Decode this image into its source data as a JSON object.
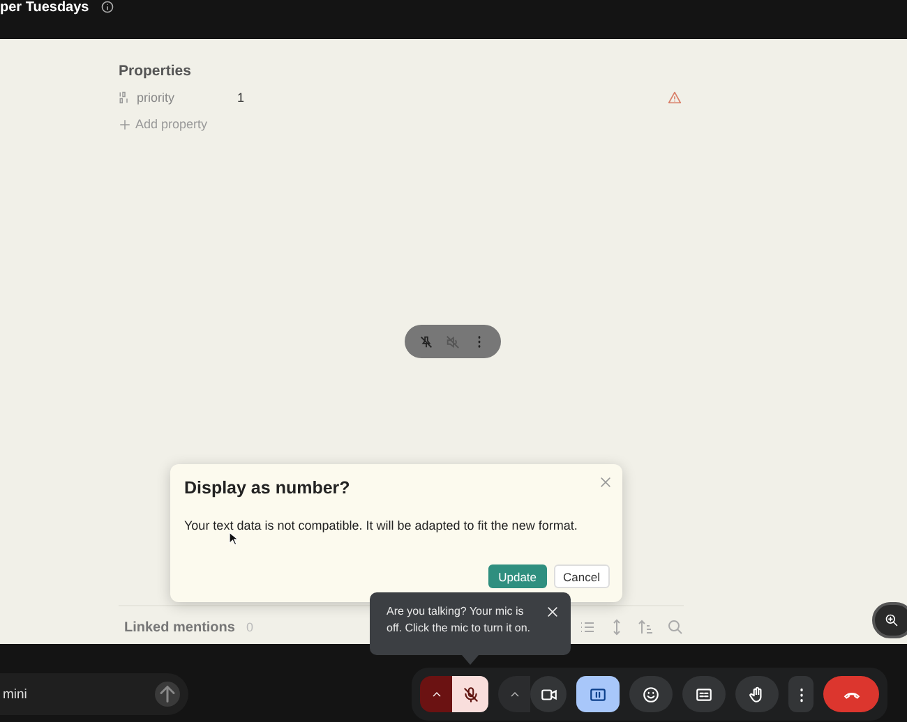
{
  "top_bar": {
    "title": "per Tuesdays"
  },
  "properties": {
    "heading": "Properties",
    "rows": [
      {
        "name": "priority",
        "value": "1",
        "warning": true
      }
    ],
    "add_label": "Add property"
  },
  "linked_mentions": {
    "label": "Linked mentions",
    "count": "0"
  },
  "dialog": {
    "title": "Display as number?",
    "message": "Your text data is not compatible. It will be adapted to fit the new format.",
    "buttons": [
      {
        "label": "Update",
        "kind": "primary"
      },
      {
        "label": "Cancel",
        "kind": "secondary"
      }
    ]
  },
  "tooltip": {
    "text": "Are you talking? Your mic is off. Click the mic to turn it on."
  },
  "composer": {
    "value": "mini"
  },
  "call_controls": [
    {
      "kind": "mic",
      "muted": true
    },
    {
      "kind": "camera",
      "muted": false
    },
    {
      "kind": "present",
      "selected": true
    },
    {
      "kind": "emoji"
    },
    {
      "kind": "captions"
    },
    {
      "kind": "hand"
    },
    {
      "kind": "more"
    },
    {
      "kind": "end"
    }
  ]
}
